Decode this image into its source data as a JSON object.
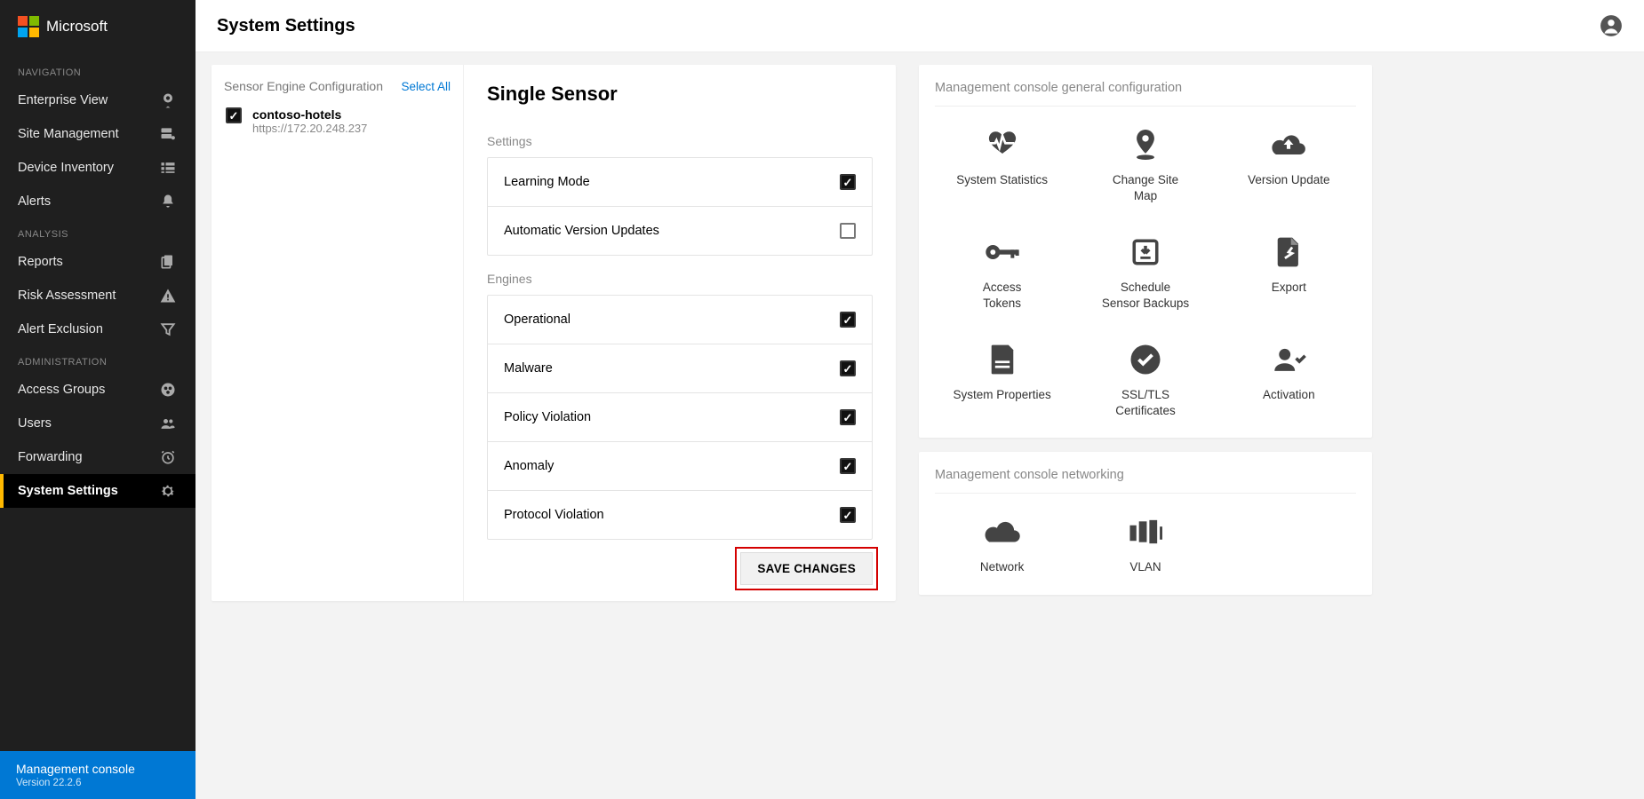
{
  "brand": "Microsoft",
  "page_title": "System Settings",
  "sidebar": {
    "sections": [
      {
        "label": "NAVIGATION",
        "items": [
          {
            "label": "Enterprise View",
            "icon": "map-pin-icon"
          },
          {
            "label": "Site Management",
            "icon": "server-icon"
          },
          {
            "label": "Device Inventory",
            "icon": "list-icon"
          },
          {
            "label": "Alerts",
            "icon": "bell-icon"
          }
        ]
      },
      {
        "label": "ANALYSIS",
        "items": [
          {
            "label": "Reports",
            "icon": "copy-icon"
          },
          {
            "label": "Risk Assessment",
            "icon": "warning-icon"
          },
          {
            "label": "Alert Exclusion",
            "icon": "filter-icon"
          }
        ]
      },
      {
        "label": "ADMINISTRATION",
        "items": [
          {
            "label": "Access Groups",
            "icon": "globe-icon"
          },
          {
            "label": "Users",
            "icon": "users-icon"
          },
          {
            "label": "Forwarding",
            "icon": "clock-icon"
          },
          {
            "label": "System Settings",
            "icon": "gear-icon",
            "active": true
          }
        ]
      }
    ],
    "footer": {
      "title": "Management console",
      "version": "Version 22.2.6"
    }
  },
  "sensor_panel": {
    "list_title": "Sensor Engine Configuration",
    "select_all": "Select All",
    "sensors": [
      {
        "name": "contoso-hotels",
        "address": "https://172.20.248.237",
        "checked": true
      }
    ],
    "detail_title": "Single Sensor",
    "settings_label": "Settings",
    "settings": [
      {
        "label": "Learning Mode",
        "checked": true
      },
      {
        "label": "Automatic Version Updates",
        "checked": false
      }
    ],
    "engines_label": "Engines",
    "engines": [
      {
        "label": "Operational",
        "checked": true
      },
      {
        "label": "Malware",
        "checked": true
      },
      {
        "label": "Policy Violation",
        "checked": true
      },
      {
        "label": "Anomaly",
        "checked": true
      },
      {
        "label": "Protocol Violation",
        "checked": true
      }
    ],
    "save_label": "SAVE CHANGES"
  },
  "right": {
    "general_title": "Management console general configuration",
    "general_tiles": [
      {
        "label": "System Statistics",
        "icon": "heartbeat-icon"
      },
      {
        "label": "Change Site Map",
        "icon": "pin-drop-icon"
      },
      {
        "label": "Version Update",
        "icon": "cloud-upload-icon"
      },
      {
        "label": "Access Tokens",
        "icon": "key-icon"
      },
      {
        "label": "Schedule Sensor Backups",
        "icon": "download-box-icon"
      },
      {
        "label": "Export",
        "icon": "file-share-icon"
      },
      {
        "label": "System Properties",
        "icon": "file-lines-icon"
      },
      {
        "label": "SSL/TLS Certificates",
        "icon": "check-circle-icon"
      },
      {
        "label": "Activation",
        "icon": "user-check-icon"
      }
    ],
    "networking_title": "Management console networking",
    "networking_tiles": [
      {
        "label": "Network",
        "icon": "cloud-icon"
      },
      {
        "label": "VLAN",
        "icon": "columns-icon"
      }
    ]
  }
}
